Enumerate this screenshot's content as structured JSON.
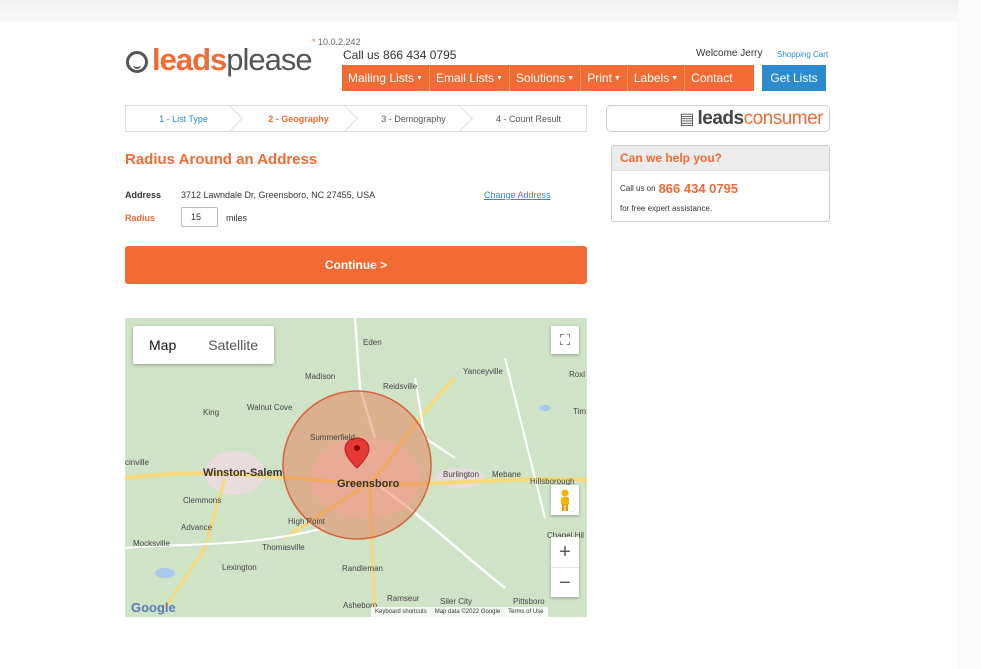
{
  "header": {
    "logo_leads": "leads",
    "logo_please": "please",
    "ip": "10.0.2.242",
    "ip_star": "*",
    "callus": "Call us 866 434 0795",
    "welcome": "Welcome Jerry",
    "cart": "Shopping Cart"
  },
  "nav": {
    "items": [
      "Mailing Lists",
      "Email Lists",
      "Solutions",
      "Print",
      "Labels",
      "Contact"
    ],
    "getlists": "Get Lists"
  },
  "steps": [
    "1 - List Type",
    "2 - Geography",
    "3 - Demography",
    "4 - Count Result"
  ],
  "consumer": {
    "leads": "leads",
    "consumer": "consumer"
  },
  "form": {
    "title": "Radius Around an Address",
    "address_label": "Address",
    "address_value": "3712 Lawndale Dr, Greensboro, NC 27455, USA",
    "change_address": "Change Address",
    "radius_label": "Radius",
    "radius_value": "15",
    "miles": "miles",
    "continue": "Continue >"
  },
  "help": {
    "title": "Can we help you?",
    "callus": "Call us on",
    "phone": "866 434 0795",
    "line2": "for free expert assistance."
  },
  "map": {
    "type_map": "Map",
    "type_satellite": "Satellite",
    "labels": {
      "eden": "Eden",
      "madison": "Madison",
      "reidsville": "Reidsville",
      "yanceyville": "Yanceyville",
      "king": "King",
      "walnut_cove": "Walnut Cove",
      "summerfield": "Summerfield",
      "winston_salem": "Winston-Salem",
      "greensboro": "Greensboro",
      "burlington": "Burlington",
      "mebane": "Mebane",
      "hillsborough": "Hillsborough",
      "clemmons": "Clemmons",
      "advance": "Advance",
      "high_point": "High Point",
      "mocksville": "Mocksville",
      "thomasville": "Thomasville",
      "lexington": "Lexington",
      "randleman": "Randleman",
      "chapel_hill": "Chapel Hil",
      "ramseur": "Ramseur",
      "siler_city": "Siler City",
      "pittsboro": "Pittsboro",
      "asheboro": "Asheboro",
      "roxl": "Roxl",
      "tim": "Tim",
      "cinville": "cinville"
    },
    "google": "Google",
    "attrib_keyboard": "Keyboard shortcuts",
    "attrib_data": "Map data ©2022 Google",
    "attrib_terms": "Terms of Use",
    "accent_circle": "#e8704a"
  }
}
